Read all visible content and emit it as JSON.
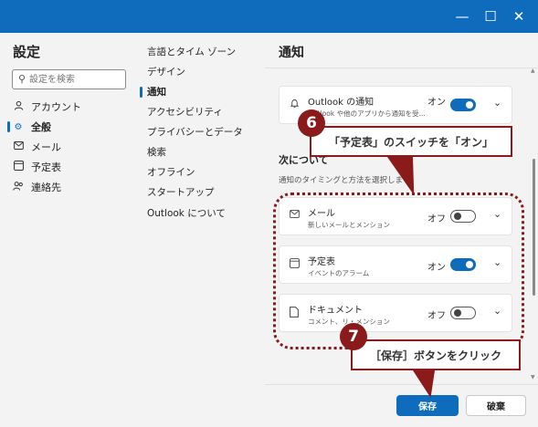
{
  "window": {
    "title": "",
    "controls": {
      "minimize": "—",
      "maximize": "☐",
      "close": "✕"
    },
    "accent_color": "#0f6cbd"
  },
  "sidebar": {
    "title": "設定",
    "search": {
      "placeholder": "設定を検索",
      "value": ""
    },
    "items": [
      {
        "label": "アカウント",
        "icon": "person-icon"
      },
      {
        "label": "全般",
        "icon": "gear-icon"
      },
      {
        "label": "メール",
        "icon": "mail-icon"
      },
      {
        "label": "予定表",
        "icon": "calendar-icon"
      },
      {
        "label": "連絡先",
        "icon": "people-icon"
      }
    ],
    "active": "全般"
  },
  "subnav": {
    "items": [
      {
        "label": "言語とタイム ゾーン"
      },
      {
        "label": "デザイン"
      },
      {
        "label": "通知"
      },
      {
        "label": "アクセシビリティ"
      },
      {
        "label": "プライバシーとデータ"
      },
      {
        "label": "検索"
      },
      {
        "label": "オフライン"
      },
      {
        "label": "スタートアップ"
      },
      {
        "label": "Outlook について"
      }
    ],
    "active": "通知"
  },
  "main": {
    "title": "通知",
    "outlook_card": {
      "title": "Outlook の通知",
      "subtitle": "Outlook や他のアプリから通知を受...",
      "state": "オン",
      "on": true
    },
    "section_heading": "次について",
    "section_desc": "通知のタイミングと方法を選択しま",
    "cards": [
      {
        "title": "メール",
        "subtitle": "新しいメールとメンション",
        "state": "オフ",
        "on": false,
        "icon": "mail-icon"
      },
      {
        "title": "予定表",
        "subtitle": "イベントのアラーム",
        "state": "オン",
        "on": true,
        "icon": "calendar-icon"
      },
      {
        "title": "ドキュメント",
        "subtitle": "コメント、リ・メンション",
        "state": "オフ",
        "on": false,
        "icon": "document-icon"
      }
    ],
    "save_label": "保存",
    "discard_label": "破棄"
  },
  "annotations": {
    "step6": {
      "number": "6",
      "text": "「予定表」のスイッチを「オン」"
    },
    "step7": {
      "number": "7",
      "text": "［保存］ボタンをクリック"
    },
    "color": "#8b1a1a"
  }
}
